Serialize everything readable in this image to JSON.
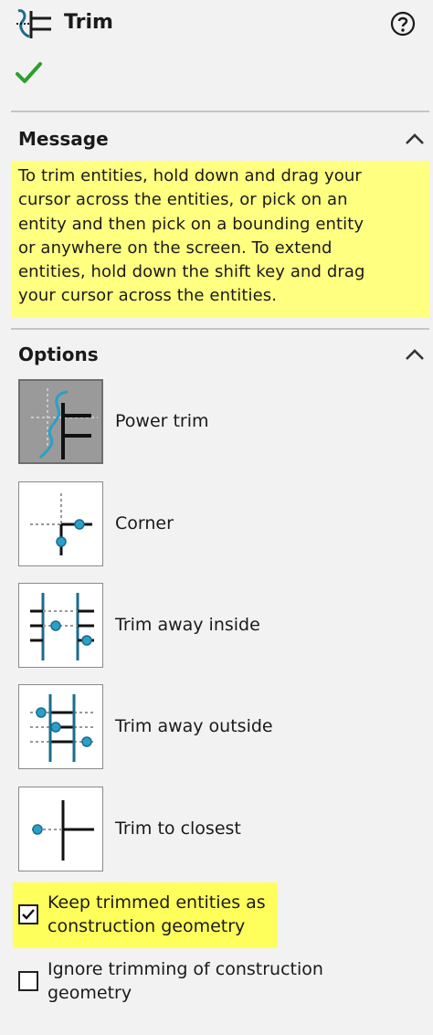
{
  "header": {
    "title": "Trim",
    "icons": {
      "tool": "trim-tool-icon",
      "help": "help-icon",
      "ok": "checkmark-icon"
    }
  },
  "message": {
    "section_title": "Message",
    "lines": [
      "To trim entities, hold down and drag your",
      "cursor across the entities, or pick on an",
      "entity and then pick on a bounding entity",
      "or anywhere on the screen.  To extend",
      "entities, hold down the shift key and drag",
      "your cursor across the entities."
    ],
    "highlight_color": "#ffff80"
  },
  "options": {
    "section_title": "Options",
    "items": [
      {
        "label": "Power trim",
        "icon": "power-trim-icon",
        "selected": true
      },
      {
        "label": "Corner",
        "icon": "corner-icon",
        "selected": false
      },
      {
        "label": "Trim away inside",
        "icon": "trim-away-inside-icon",
        "selected": false
      },
      {
        "label": "Trim away outside",
        "icon": "trim-away-outside-icon",
        "selected": false
      },
      {
        "label": "Trim to closest",
        "icon": "trim-to-closest-icon",
        "selected": false
      }
    ]
  },
  "checkboxes": [
    {
      "lines": [
        "Keep trimmed entities as",
        "construction geometry"
      ],
      "checked": true,
      "highlighted": true
    },
    {
      "lines": [
        "Ignore trimming of construction",
        "geometry"
      ],
      "checked": false,
      "highlighted": false
    }
  ],
  "colors": {
    "accent_blue": "#1a6c8c",
    "ok_green": "#2e9e2e",
    "highlight_yellow": "#ffff5c"
  }
}
